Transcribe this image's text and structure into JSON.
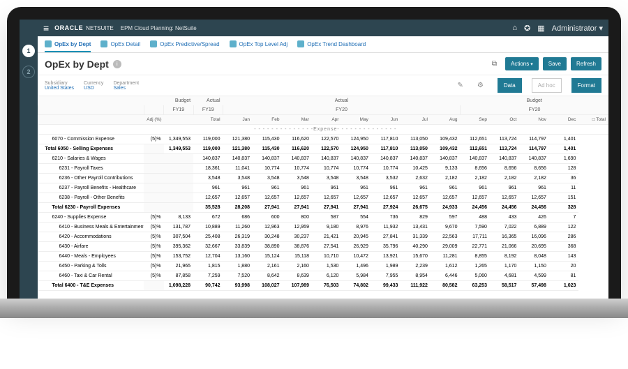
{
  "topbar": {
    "brand_main": "ORACLE",
    "brand_sub": "NETSUITE",
    "crumb": "EPM Cloud Planning: NetSuite",
    "user_label": "Administrator",
    "caret": "▾"
  },
  "leftrail": {
    "step1": "1",
    "step2": "2"
  },
  "tabs": {
    "t1": "OpEx by Dept",
    "t2": "OpEx Detail",
    "t3": "OpEx Predictive/Spread",
    "t4": "OpEx Top Level Adj",
    "t5": "OpEx Trend Dashboard"
  },
  "title": {
    "text": "OpEx by Dept",
    "actions": "Actions",
    "save": "Save",
    "refresh": "Refresh"
  },
  "filters": {
    "f1_label": "Subsidiary",
    "f1_value": "United States",
    "f2_label": "Currency",
    "f2_value": "USD",
    "f3_label": "Department",
    "f3_value": "Sales",
    "btn_data": "Data",
    "btn_adhoc": "Ad hoc",
    "btn_format": "Format"
  },
  "headers": {
    "budget": "Budget",
    "actual": "Actual",
    "fy19": "FY19",
    "fy20": "FY20",
    "adj": "Adj (%)",
    "total": "Total",
    "jan": "Jan",
    "feb": "Feb",
    "mar": "Mar",
    "apr": "Apr",
    "may": "May",
    "jun": "Jun",
    "jul": "Jul",
    "aug": "Aug",
    "sep": "Sep",
    "oct": "Oct",
    "nov": "Nov",
    "dec": "Dec",
    "box_total": "□ Total",
    "expense_sep": "- - - - - - - - - - - - - -Expense- - - - - - - - - - - - - -"
  },
  "rows": [
    {
      "label": "6070 - Commission Expense",
      "indent": 1,
      "adj": "(5)%",
      "budget": "1,349,553",
      "total": "119,000",
      "m": [
        "121,380",
        "115,430",
        "116,620",
        "122,570",
        "124,950",
        "117,810",
        "113,050",
        "109,432",
        "112,651",
        "113,724",
        "114,797"
      ],
      "rtot": "1,401"
    },
    {
      "label": "Total 6050 - Selling Expenses",
      "indent": 0,
      "bold": true,
      "adj": "",
      "budget": "1,349,553",
      "total": "119,000",
      "m": [
        "121,380",
        "115,430",
        "116,620",
        "122,570",
        "124,950",
        "117,810",
        "113,050",
        "109,432",
        "112,651",
        "113,724",
        "114,797"
      ],
      "rtot": "1,401"
    },
    {
      "label": "6210 - Salaries & Wages",
      "indent": 1,
      "adj": "",
      "budget": "",
      "total": "140,837",
      "m": [
        "140,837",
        "140,837",
        "140,837",
        "140,837",
        "140,837",
        "140,837",
        "140,837",
        "140,837",
        "140,837",
        "140,837",
        "140,837"
      ],
      "rtot": "1,690"
    },
    {
      "label": "6231 - Payroll Taxes",
      "indent": 2,
      "adj": "",
      "budget": "",
      "total": "18,361",
      "m": [
        "11,041",
        "10,774",
        "10,774",
        "10,774",
        "10,774",
        "10,774",
        "10,425",
        "9,133",
        "8,656",
        "8,656",
        "8,656"
      ],
      "rtot": "128"
    },
    {
      "label": "6236 - Other Payroll Contributions",
      "indent": 2,
      "adj": "",
      "budget": "",
      "total": "3,548",
      "m": [
        "3,548",
        "3,548",
        "3,548",
        "3,548",
        "3,548",
        "3,532",
        "2,632",
        "2,182",
        "2,182",
        "2,182",
        "2,182"
      ],
      "rtot": "36"
    },
    {
      "label": "6237 - Payroll Benefits - Healthcare",
      "indent": 2,
      "adj": "",
      "budget": "",
      "total": "961",
      "m": [
        "961",
        "961",
        "961",
        "961",
        "961",
        "961",
        "961",
        "961",
        "961",
        "961",
        "961"
      ],
      "rtot": "11"
    },
    {
      "label": "6238 - Payroll - Other Benefits",
      "indent": 2,
      "adj": "",
      "budget": "",
      "total": "12,657",
      "m": [
        "12,657",
        "12,657",
        "12,657",
        "12,657",
        "12,657",
        "12,657",
        "12,657",
        "12,657",
        "12,657",
        "12,657",
        "12,657"
      ],
      "rtot": "151"
    },
    {
      "label": "Total 6230 - Payroll Expenses",
      "indent": 1,
      "bold": true,
      "adj": "",
      "budget": "",
      "total": "35,528",
      "m": [
        "28,208",
        "27,941",
        "27,941",
        "27,941",
        "27,941",
        "27,924",
        "26,675",
        "24,933",
        "24,456",
        "24,456",
        "24,456"
      ],
      "rtot": "328"
    },
    {
      "label": "6240 - Supplies Expense",
      "indent": 1,
      "adj": "(5)%",
      "budget": "8,133",
      "total": "672",
      "m": [
        "686",
        "600",
        "800",
        "587",
        "554",
        "736",
        "829",
        "597",
        "488",
        "433",
        "426"
      ],
      "rtot": "7"
    },
    {
      "label": "6410 - Business Meals & Entertainment",
      "indent": 2,
      "adj": "(5)%",
      "budget": "131,787",
      "total": "10,889",
      "m": [
        "11,260",
        "12,963",
        "12,959",
        "9,180",
        "8,976",
        "11,932",
        "13,431",
        "9,670",
        "7,590",
        "7,022",
        "6,889"
      ],
      "rtot": "122"
    },
    {
      "label": "6420 - Accommodations",
      "indent": 2,
      "adj": "(5)%",
      "budget": "307,504",
      "total": "25,408",
      "m": [
        "26,319",
        "30,248",
        "30,237",
        "21,421",
        "20,945",
        "27,841",
        "31,339",
        "22,563",
        "17,711",
        "16,365",
        "16,096"
      ],
      "rtot": "286"
    },
    {
      "label": "6430 - Airfare",
      "indent": 2,
      "adj": "(5)%",
      "budget": "395,362",
      "total": "32,667",
      "m": [
        "33,839",
        "38,890",
        "38,876",
        "27,541",
        "26,929",
        "35,796",
        "40,290",
        "29,009",
        "22,771",
        "21,066",
        "20,695"
      ],
      "rtot": "368"
    },
    {
      "label": "6440 - Meals - Employees",
      "indent": 2,
      "adj": "(5)%",
      "budget": "153,752",
      "total": "12,704",
      "m": [
        "13,160",
        "15,124",
        "15,118",
        "10,710",
        "10,472",
        "13,921",
        "15,670",
        "11,281",
        "8,855",
        "8,192",
        "8,048"
      ],
      "rtot": "143"
    },
    {
      "label": "6450 - Parking & Tolls",
      "indent": 2,
      "adj": "(5)%",
      "budget": "21,965",
      "total": "1,815",
      "m": [
        "1,880",
        "2,161",
        "2,160",
        "1,530",
        "1,496",
        "1,989",
        "2,239",
        "1,612",
        "1,265",
        "1,170",
        "1,150"
      ],
      "rtot": "20"
    },
    {
      "label": "6460 - Taxi & Car Rental",
      "indent": 2,
      "adj": "(5)%",
      "budget": "87,858",
      "total": "7,259",
      "m": [
        "7,520",
        "8,642",
        "8,639",
        "6,120",
        "5,984",
        "7,955",
        "8,954",
        "6,446",
        "5,060",
        "4,681",
        "4,599"
      ],
      "rtot": "81"
    },
    {
      "label": "Total 6400 - T&E Expenses",
      "indent": 1,
      "bold": true,
      "adj": "",
      "budget": "1,098,228",
      "total": "90,742",
      "m": [
        "93,998",
        "108,027",
        "107,989",
        "76,503",
        "74,802",
        "99,433",
        "111,922",
        "80,582",
        "63,253",
        "58,517",
        "57,498"
      ],
      "rtot": "1,023"
    }
  ]
}
